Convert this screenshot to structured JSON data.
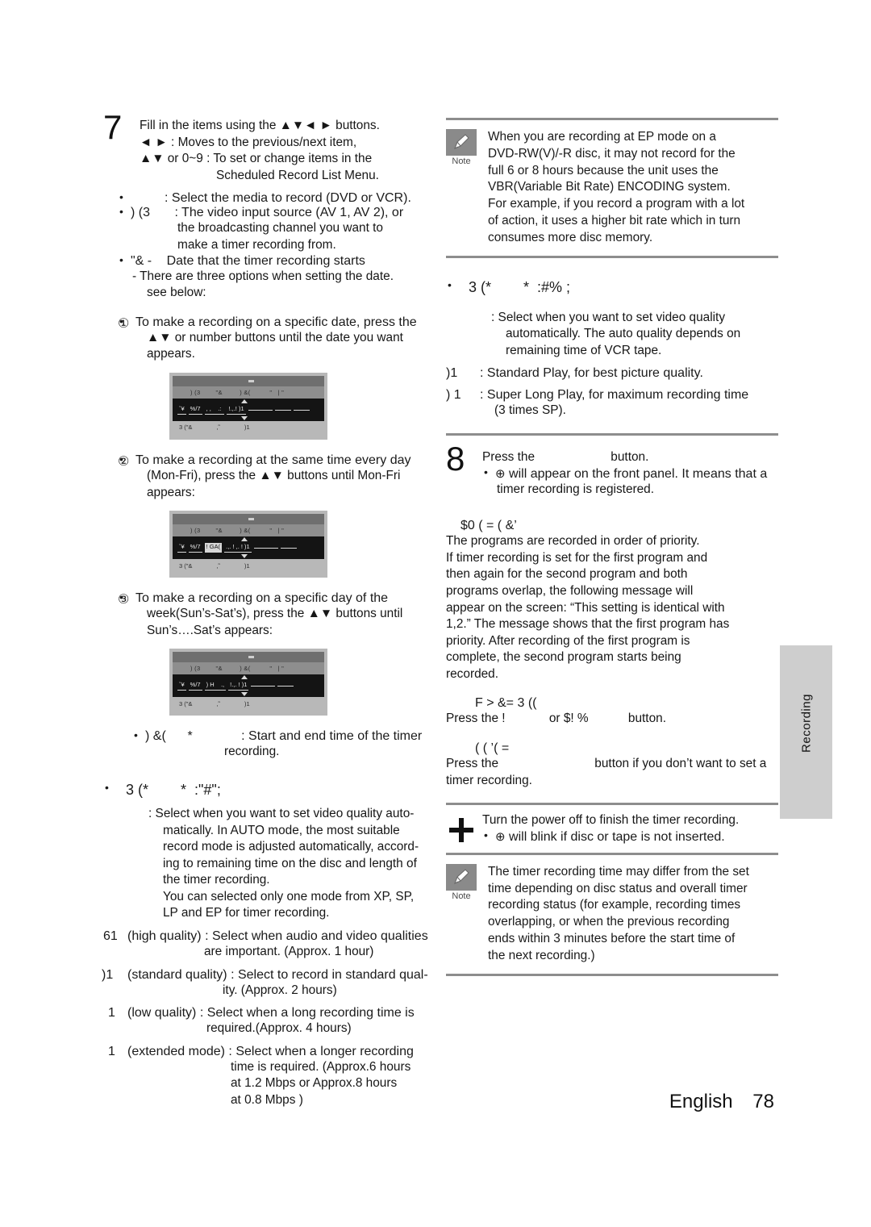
{
  "page": {
    "footer_language": "English",
    "footer_page_number": "78",
    "side_tab_label": "Recording"
  },
  "left_column": {
    "step7": {
      "number": "7",
      "lines": [
        "Fill in the items using the ▲▼◄ ► buttons.",
        "◄ ► : Moves to the previous/next item,",
        "▲▼ or 0~9 : To set or change items in the",
        "Scheduled Record List Menu."
      ]
    },
    "items": [
      {
        "label": "",
        "text": ": Select the media to record (DVD or VCR)."
      },
      {
        "label": ") (3",
        "text": ": The video input source (AV 1, AV 2), or"
      },
      {
        "label": "",
        "text": "the broadcasting channel you want to"
      },
      {
        "label": "",
        "text": "make a timer recording from."
      },
      {
        "label": "\"& -",
        "text": "Date that the timer recording starts"
      }
    ],
    "date_note": [
      "- There are three options when setting the date.",
      "see below:"
    ],
    "option1": {
      "marker": "①",
      "lines": [
        "To make a recording on a specific date, press the",
        "▲▼ or number buttons until the date you want",
        "appears."
      ]
    },
    "option2": {
      "marker": "②",
      "lines": [
        "To make a recording at the same time every day",
        "(Mon-Fri), press the ▲▼ buttons until Mon-Fri",
        "appears:"
      ]
    },
    "option3": {
      "marker": "③",
      "lines": [
        "To make a recording on a specific day of the",
        "week(Sun’s-Sat’s), press the ▲▼ buttons until",
        "Sun’s….Sat’s appears:"
      ]
    },
    "osd_figures": [
      {
        "title_bar": "",
        "header": ") (3        \"&         ) &(          \"   | \"",
        "cells": [
          "ˇ¥",
          "%/7",
          ", ,    .: ",
          "!.,.! )1",
          "",
          "",
          ""
        ],
        "highlight": "",
        "footer_left": "3 (\"&",
        "footer_mid": ",˜",
        "footer_right": ")1"
      },
      {
        "title_bar": "",
        "header": ") (3        \"&         ) &(          \"   | \"",
        "cells": [
          "ˇ¥",
          "%/7",
          "! GA(",
          ".,. ! ,. ! )1",
          "",
          ""
        ],
        "highlight": "! GA(",
        "footer_left": "3 (\"&",
        "footer_mid": ",˜",
        "footer_right": ")1"
      },
      {
        "title_bar": "",
        "header": ") (3        \"&         ) &(          \"   | \"",
        "cells": [
          "ˇ¥",
          "%/7",
          ") H    .,",
          "!.,. ! )1",
          "",
          ""
        ],
        "highlight": "",
        "footer_left": "3 (\"&",
        "footer_mid": ",˜",
        "footer_right": ")1"
      }
    ],
    "time_item": {
      "label": ") &(      *",
      "text_line1": ": Start and end time of the timer",
      "text_line2": "recording."
    },
    "rec_mode_heading": "3 (*        *  :\"#\";",
    "rec_mode_body": [
      ": Select when you want to set video quality auto-",
      "matically. In AUTO mode, the most suitable",
      "record mode is adjusted automatically, accord-",
      "ing to remaining time on the disc and length of",
      "the timer recording.",
      "You can selected only one mode from XP, SP,",
      "LP and EP for timer recording."
    ],
    "quality_modes": [
      {
        "code": "61",
        "name": "(high quality)",
        "lines": [
          ": Select when audio and video qualities",
          "are important. (Approx. 1 hour)"
        ]
      },
      {
        "code": ")1",
        "name": "(standard quality)",
        "lines": [
          ": Select to record in standard qual-",
          "ity. (Approx. 2 hours)"
        ]
      },
      {
        "code": "1",
        "name": "(low quality)",
        "lines": [
          ": Select when a long recording time is",
          "required.(Approx. 4 hours)"
        ]
      },
      {
        "code": "1",
        "name": "(extended mode)",
        "lines": [
          ": Select when a longer recording",
          "time is required. (Approx.6 hours",
          "at 1.2 Mbps or Approx.8 hours",
          "at 0.8 Mbps )"
        ]
      }
    ]
  },
  "right_column": {
    "note1": {
      "badge_label": "Note",
      "lines": [
        "When you are recording at EP mode on a",
        "DVD-RW(V)/-R disc, it may not record for the",
        "full 6 or 8 hours because the unit uses the",
        "VBR(Variable Bit Rate) ENCODING system.",
        "For example, if you record a program with a lot",
        "of action, it uses a higher bit rate which in turn",
        "consumes more disc memory."
      ]
    },
    "vcr_mode_heading": "3 (*        *  :#% ;",
    "vcr_mode_body": [
      ": Select when you want to set video quality",
      "automatically. The auto quality depends on",
      "remaining time of VCR tape."
    ],
    "vcr_modes": [
      {
        "code": ")1",
        "text": ": Standard Play, for best picture quality."
      },
      {
        "code": ") 1",
        "text": ": Super Long Play, for maximum recording time"
      },
      {
        "code": "",
        "text": "(3 times SP)."
      }
    ],
    "step8": {
      "number": "8",
      "line1_pre": "Press the",
      "line1_post": "button.",
      "bullet_glyph": "⊕",
      "bullet_line1": "will appear on the front panel. It means that a",
      "bullet_line2": "timer recording is registered."
    },
    "priority_heading": "$0        (             = ( &’",
    "priority_body": [
      "The programs are recorded in order of priority.",
      "If timer recording is set for the first program and",
      "then again for the second program and both",
      "programs overlap, the following message will",
      "appear on the screen: “This setting is identical with",
      "1,2.” The message shows that the first program has",
      "priority. After recording of the first program is",
      "complete, the second program starts being",
      "recorded."
    ],
    "cancel_heading": "F  >      &=       3 ((",
    "cancel_line_pre": "Press the !",
    "cancel_line_mid": "or  $!    %",
    "cancel_line_post": "button.",
    "exit_heading": "(  (           ’( =",
    "exit_line1_pre": "Press the",
    "exit_line1_post": "button if you don’t want to set a",
    "exit_line2": "timer recording.",
    "step_plus": {
      "line1": "Turn the power off to finish the timer recording.",
      "bullet_glyph": "⊕",
      "bullet_line": "will blink if disc or tape is not inserted."
    },
    "note2": {
      "badge_label": "Note",
      "lines": [
        "The timer recording time may differ from the set",
        "time depending on disc status and overall timer",
        "recording status (for example, recording times",
        "overlapping, or when the previous recording",
        "ends within 3 minutes before the start time of",
        "the next recording.)"
      ]
    }
  }
}
